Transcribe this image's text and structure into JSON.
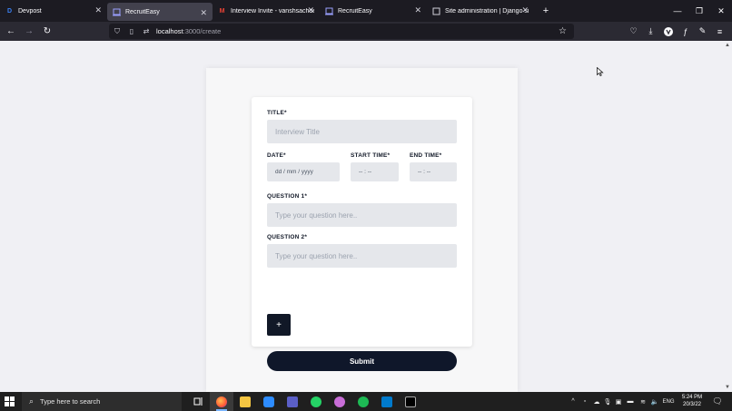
{
  "browser": {
    "tabs": [
      {
        "title": "Devpost",
        "favicon": "D",
        "color": "#3b82f6",
        "active": false
      },
      {
        "title": "RecruitEasy",
        "favicon": "page-icon",
        "color": "#9aa0ff",
        "active": true
      },
      {
        "title": "Interview Invite - vanshsachdev",
        "favicon": "M",
        "color": "#ea4335",
        "active": false
      },
      {
        "title": "RecruitEasy",
        "favicon": "page-icon",
        "color": "#9aa0ff",
        "active": false
      },
      {
        "title": "Site administration | Django site ad",
        "favicon": "page-icon",
        "color": "#cfcfd8",
        "active": false
      }
    ],
    "url_host": "localhost",
    "url_path": ":3000/create"
  },
  "form": {
    "title_label": "TITLE*",
    "title_placeholder": "Interview Title",
    "date_label": "DATE*",
    "date_placeholder": "dd / mm / yyyy",
    "start_label": "START TIME*",
    "start_placeholder": "-- : --",
    "end_label": "END TIME*",
    "end_placeholder": "-- : --",
    "q1_label": "QUESTION 1*",
    "q1_placeholder": "Type your question here..",
    "q2_label": "QUESTION 2*",
    "q2_placeholder": "Type your question here..",
    "add_label": "+",
    "submit_label": "Submit"
  },
  "taskbar": {
    "search_placeholder": "Type here to search",
    "language": "ENG",
    "time": "5:24 PM",
    "date": "20/3/22"
  },
  "colors": {
    "button_dark": "#0f172a",
    "input_bg": "#e5e7eb"
  }
}
